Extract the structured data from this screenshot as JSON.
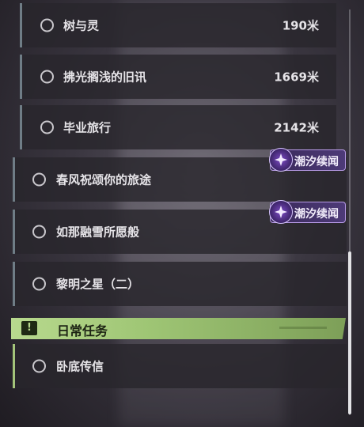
{
  "quests": [
    {
      "label": "树与灵",
      "distance": "190米"
    },
    {
      "label": "拂光搁浅的旧讯",
      "distance": "1669米"
    },
    {
      "label": "毕业旅行",
      "distance": "2142米"
    },
    {
      "label": "春风祝颂你的旅途"
    },
    {
      "label": "如那融雪所愿般"
    },
    {
      "label": "黎明之星（二）"
    }
  ],
  "badge": {
    "label": "潮汐续闻"
  },
  "daily_section": {
    "title": "日常任务",
    "icon": "!"
  },
  "daily_quests": [
    {
      "label": "卧底传信"
    }
  ],
  "colors": {
    "accent_green": "#a3c47a",
    "badge_purple": "#4d3a78",
    "quest_bar": "#6f7d86"
  }
}
